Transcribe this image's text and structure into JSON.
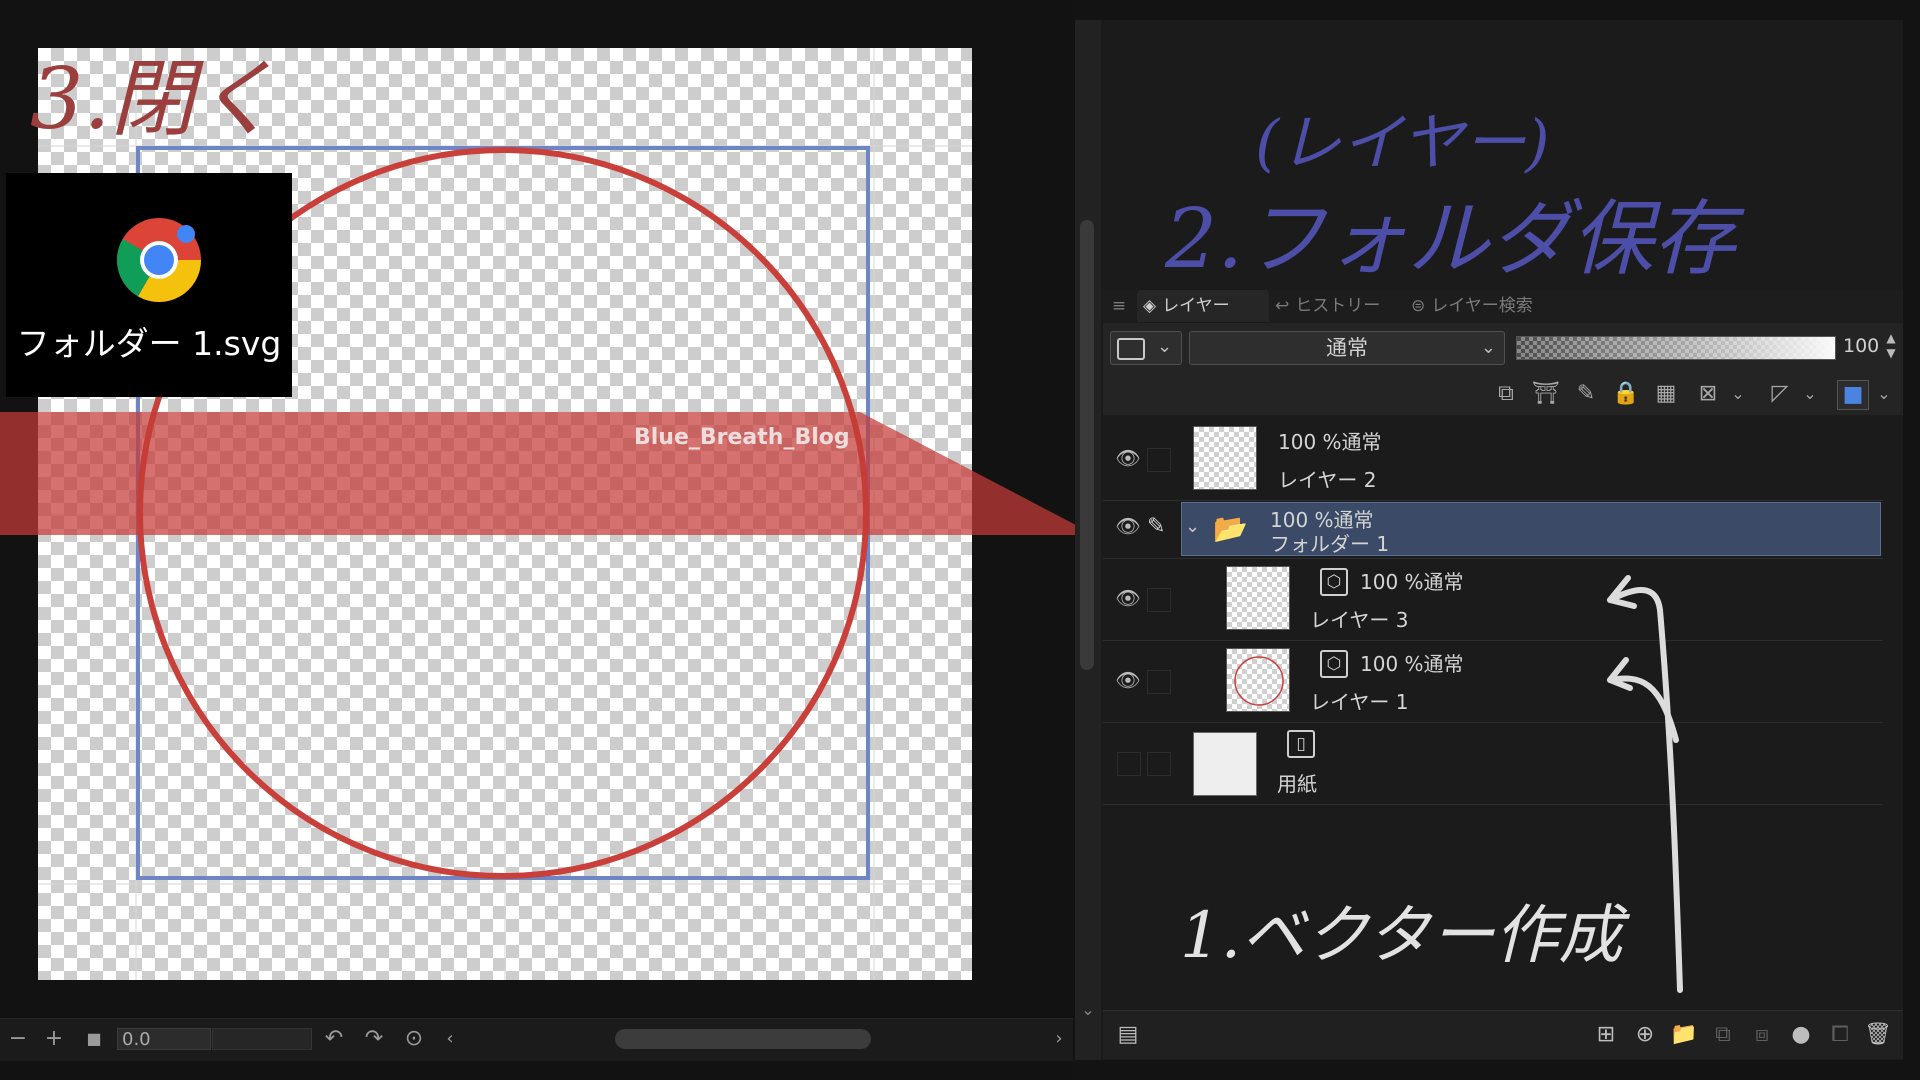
{
  "popup": {
    "file_label": "フォルダー 1.svg"
  },
  "watermark": "Blue_Breath_Blog",
  "annotations": {
    "step3": "3.閉く",
    "layer_heading": "(レイヤー)",
    "step2": "2.フォルダ保存",
    "step1": "1.ベクター作成"
  },
  "canvas_toolbar": {
    "zoom_value": "0.0"
  },
  "panel": {
    "tabs": [
      "レイヤー",
      "ヒストリー",
      "レイヤー検索"
    ],
    "blend_mode": "通常",
    "opacity": "100"
  },
  "layers": [
    {
      "line1": "100 %通常",
      "line2": "レイヤー 2",
      "visible": true
    },
    {
      "line1": "100 %通常",
      "line2": "フォルダー 1",
      "visible": true,
      "selected": true
    },
    {
      "line1": "100 %通常",
      "line2": "レイヤー 3",
      "visible": true
    },
    {
      "line1": "100 %通常",
      "line2": "レイヤー 1",
      "visible": true
    },
    {
      "line2": "用紙",
      "visible": false
    }
  ],
  "colors": {
    "accent_selected": "#3a4a67",
    "circle_stroke": "#c9403b",
    "frame_stroke": "#6f86c6",
    "band_fill": "#c53a36",
    "annotation_red": "#9a3e3e",
    "annotation_blue": "#4d4ea8",
    "annotation_white": "#e2e2e2"
  }
}
